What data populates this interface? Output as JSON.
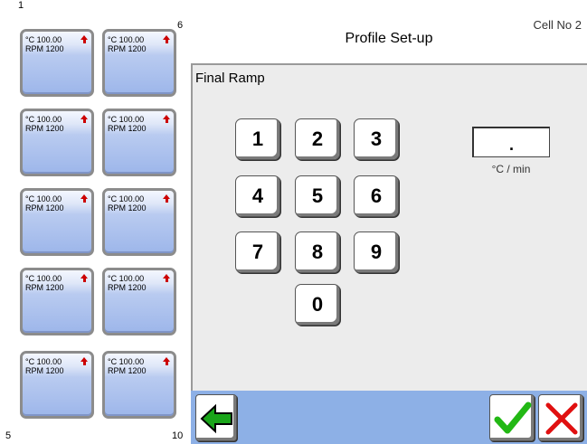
{
  "header": {
    "title": "Profile Set-up",
    "cell_no": "Cell No  2"
  },
  "grid": {
    "corner_top_left": "1",
    "corner_top_right": "6",
    "corner_bottom_left": "5",
    "corner_bottom_right": "10",
    "cells": [
      {
        "temp": "°C 100.00",
        "rpm": "RPM 1200"
      },
      {
        "temp": "°C 100.00",
        "rpm": "RPM 1200"
      },
      {
        "temp": "°C 100.00",
        "rpm": "RPM 1200"
      },
      {
        "temp": "°C 100.00",
        "rpm": "RPM 1200"
      },
      {
        "temp": "°C 100.00",
        "rpm": "RPM 1200"
      },
      {
        "temp": "°C 100.00",
        "rpm": "RPM 1200"
      },
      {
        "temp": "°C 100.00",
        "rpm": "RPM 1200"
      },
      {
        "temp": "°C 100.00",
        "rpm": "RPM 1200"
      },
      {
        "temp": "°C 100.00",
        "rpm": "RPM 1200"
      },
      {
        "temp": "°C 100.00",
        "rpm": "RPM 1200"
      }
    ],
    "status_icon": "red-up-arrow-icon"
  },
  "panel": {
    "title": "Final Ramp",
    "value": ".",
    "unit": "°C / min"
  },
  "keypad": {
    "k1": "1",
    "k2": "2",
    "k3": "3",
    "k4": "4",
    "k5": "5",
    "k6": "6",
    "k7": "7",
    "k8": "8",
    "k9": "9",
    "k0": "0"
  },
  "buttons": {
    "back_icon": "green-left-arrow-icon",
    "confirm_icon": "green-check-icon",
    "cancel_icon": "red-x-icon"
  },
  "colors": {
    "tile": "#9db6ea",
    "bottom_bar": "#8db0e6",
    "arrow": "#cc0000",
    "check": "#22b814",
    "cancel": "#e01010"
  }
}
